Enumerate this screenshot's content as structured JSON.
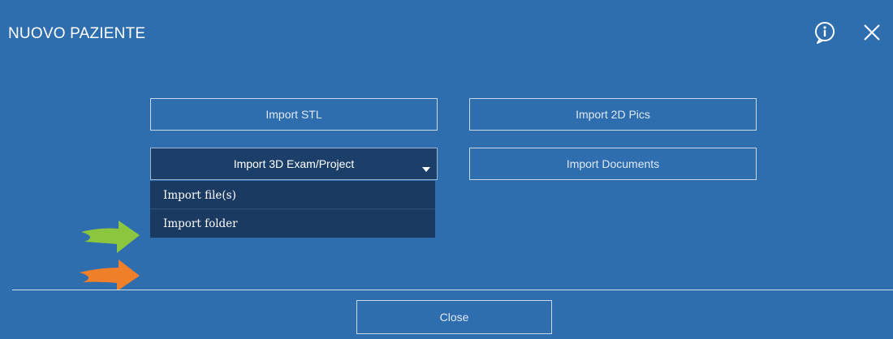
{
  "dialog": {
    "title": "NUOVO PAZIENTE",
    "header_icons": [
      "info-icon",
      "close-icon"
    ]
  },
  "buttons": {
    "import_stl": "Import STL",
    "import_2d_pics": "Import 2D Pics",
    "import_3d_exam": "Import 3D Exam/Project",
    "import_documents": "Import Documents"
  },
  "dropdown": {
    "items": [
      {
        "label": "Import file(s)"
      },
      {
        "label": "Import folder"
      }
    ]
  },
  "footer": {
    "close_label": "Close"
  },
  "colors": {
    "background": "#2e6dae",
    "dropdown_bg": "#1a3a61",
    "selected_button_bg": "#1c3f69",
    "button_border": "#c9d9ec",
    "arrow_green": "#8cc63f",
    "arrow_orange": "#f07f2a"
  }
}
